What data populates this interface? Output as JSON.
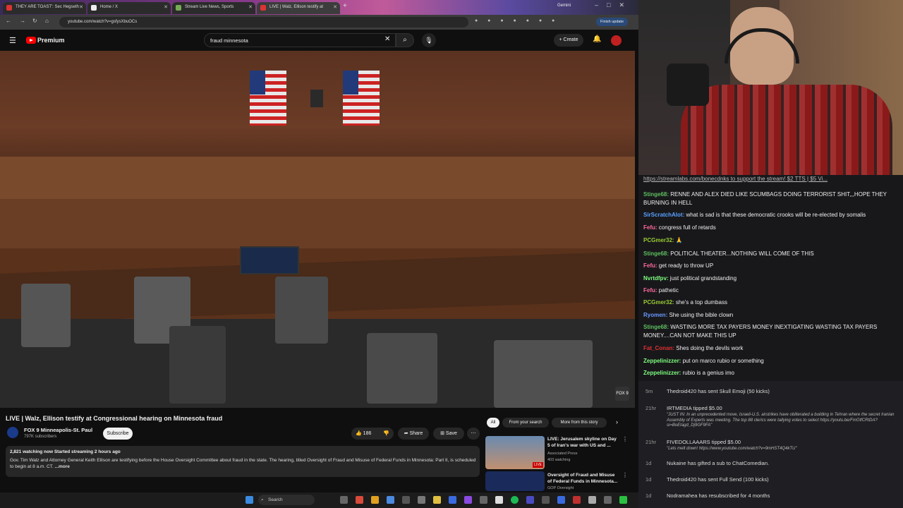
{
  "browser": {
    "tabs": [
      {
        "title": "THEY ARE TOAST': Sec Hegseth",
        "color": "#d33"
      },
      {
        "title": "Home / X",
        "color": "#eee"
      },
      {
        "title": "Stream Live News, Sports",
        "color": "#7a5"
      },
      {
        "title": "LIVE | Walz, Ellison testify at",
        "color": "#d33",
        "active": true
      }
    ],
    "gemini": "Gemini",
    "url": "youtube.com/watch?v=gsfysXbuOCs",
    "finish_update": "Finish update"
  },
  "youtube": {
    "logo": "Premium",
    "search_value": "fraud minnesota",
    "create": "Create",
    "video_title": "LIVE | Walz, Ellison testify at Congressional hearing on Minnesota fraud",
    "channel": "FOX 9 Minneapolis-St. Paul",
    "subscribers": "797K subscribers",
    "subscribe": "Subscribe",
    "likes": "186",
    "share": "Share",
    "save": "Save",
    "watching": "2,821 watching now  Started streaming 2 hours ago",
    "description": "Gov. Tim Walz and Attorney General Keith Ellison are testifying before the House Oversight Committee about fraud in the state. The hearing, titled Oversight of Fraud and Misuse of Federal Funds in Minnesota: Part II, is scheduled to begin at 8 a.m. CT.",
    "more": "...more",
    "chips": [
      "All",
      "From your search",
      "More from this story"
    ],
    "recommendations": [
      {
        "title": "LIVE: Jerusalem skyline on Day 5 of Iran's war with US and ...",
        "channel": "Associated Press",
        "meta": "403 watching",
        "badge": "LIVE"
      },
      {
        "title": "Oversight of Fraud and Misuse of Federal Funds in Minnesota...",
        "channel": "GOP Oversight",
        "meta": ""
      }
    ],
    "fox_bug": "FOX 9"
  },
  "chat": {
    "banner": "https://streamlabs.com/bonecdnks to support the stream! $2 TTS | $5 Vi...",
    "messages": [
      {
        "user": "Stinge68:",
        "color": "#5fbf5f",
        "text": "RENNE AND ALEX DIED LIKE SCUMBAGS DOING TERRORIST SHIT,,,HOPE THEY BURNING IN HELL"
      },
      {
        "user": "SirScratchAlot:",
        "color": "#5aa0ff",
        "text": "what is sad is that these democratic crooks will be re-elected by somalis"
      },
      {
        "user": "Fefu:",
        "color": "#ff6a9a",
        "text": "congress full of retards"
      },
      {
        "user": "PCGmer32:",
        "color": "#9acd32",
        "text": ""
      },
      {
        "user": "Stinge68:",
        "color": "#5fbf5f",
        "text": "POLITICAL THEATER...NOTHING WILL COME OF THIS"
      },
      {
        "user": "Fefu:",
        "color": "#ff6a9a",
        "text": "get ready to throw UP"
      },
      {
        "user": "Nvrtdfpv:",
        "color": "#7fff7f",
        "text": "just political grandstanding"
      },
      {
        "user": "Fefu:",
        "color": "#ff6a9a",
        "text": "pathetic"
      },
      {
        "user": "PCGmer32:",
        "color": "#9acd32",
        "text": "she's a top dumbass"
      },
      {
        "user": "Ryomen:",
        "color": "#6a9aff",
        "text": "She using the bible clown"
      },
      {
        "user": "Stinge68:",
        "color": "#5fbf5f",
        "text": "WASTING MORE TAX PAYERS MONEY INEXTIGATING WASTING TAX PAYERS MONEY....CAN NOT MAKE THIS UP"
      },
      {
        "user": "Fat_Conan:",
        "color": "#e03030",
        "text": "Shes doing the devils work"
      },
      {
        "user": "Zeppelinizzer:",
        "color": "#7fff7f",
        "text": "put on marco rubio or something"
      },
      {
        "user": "Zeppelinizzer:",
        "color": "#7fff7f",
        "text": "rubio is a genius imo"
      }
    ]
  },
  "events": [
    {
      "time": "5m",
      "text": "Thedroid420 has sent Skull Emoji (50 kicks)"
    },
    {
      "time": "21hr",
      "text": "IRTMEDIA tipped $5.00",
      "sub": "\"JUST IN: In an unprecedented move, Israeli-U.S. airstrikes have obliterated a building in Tehran where the secret Iranian Assembly of Experts was meeting. The top 88 clerics were tallying votes to select https://youtu.be/FmOtfCRtDA?si=BoEtagd_Dj9GF9FA\""
    },
    {
      "time": "21hr",
      "text": "FIVEDOLLAAARS tipped $5.00",
      "sub": "\"Lets melt down! https://www.youtube.com/watch?v=9mHST4Q4kTU\""
    },
    {
      "time": "1d",
      "text": "Nukaine has gifted a sub to ChatComedian."
    },
    {
      "time": "1d",
      "text": "Thedroid420 has sent Full Send (100 kicks)"
    },
    {
      "time": "1d",
      "text": "Nodramahea has resubscribed for 4 months"
    }
  ],
  "taskbar": {
    "search": "Search"
  }
}
